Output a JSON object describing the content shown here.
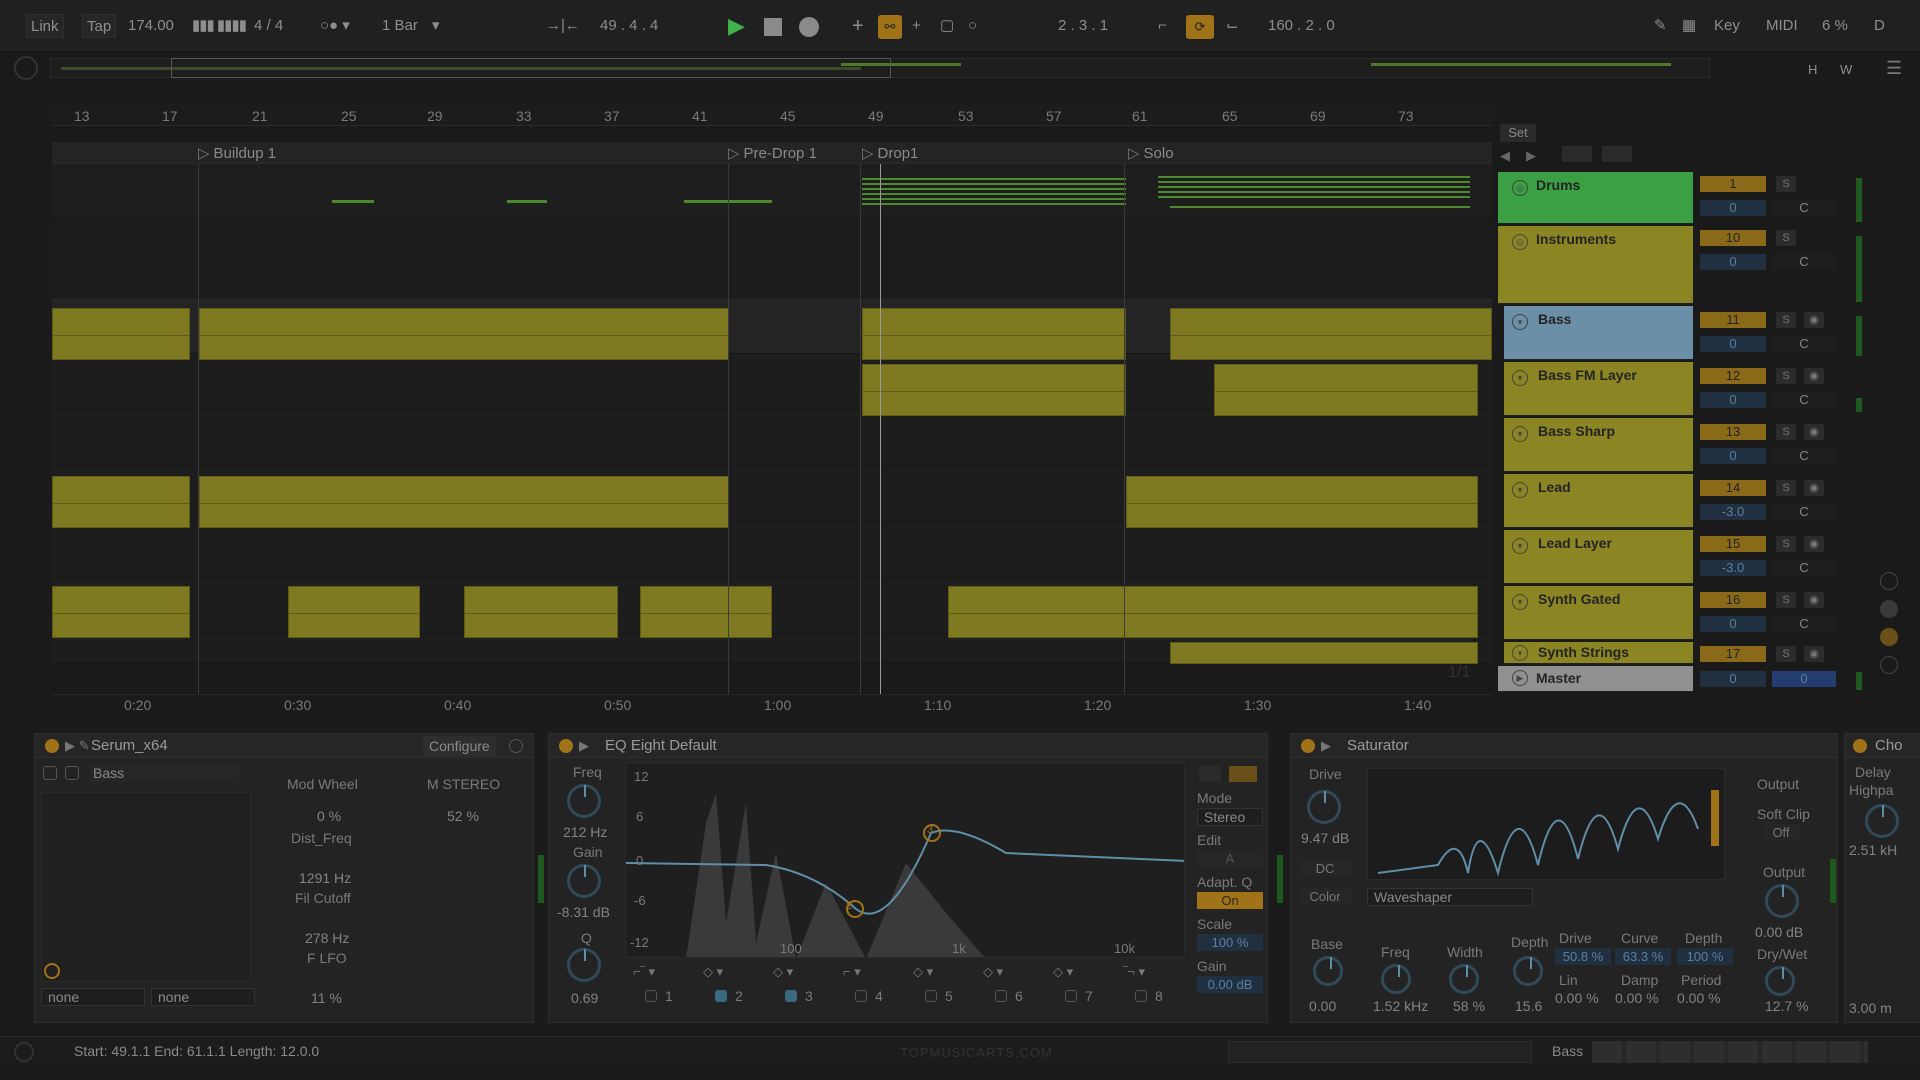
{
  "transport": {
    "link": "Link",
    "tap": "Tap",
    "tempo": "174.00",
    "time_sig": "4 / 4",
    "quantize": "1 Bar",
    "position": "49 .  4 .  4",
    "loop_start": "2 .  3 .  1",
    "loop_length": "160 .  2 .  0",
    "key": "Key",
    "midi": "MIDI",
    "cpu": "6 %",
    "d": "D"
  },
  "overview_buttons": {
    "h": "H",
    "w": "W"
  },
  "ruler": [
    "13",
    "17",
    "21",
    "25",
    "29",
    "33",
    "37",
    "41",
    "45",
    "49",
    "53",
    "57",
    "61",
    "65",
    "69",
    "73"
  ],
  "locators": [
    "Buildup 1",
    "Pre-Drop 1",
    "Drop1",
    "Solo"
  ],
  "time_ruler": [
    "0:20",
    "0:30",
    "0:40",
    "0:50",
    "1:00",
    "1:10",
    "1:20",
    "1:30",
    "1:40"
  ],
  "set_label": "Set",
  "page_indicator": "1/1",
  "tracks": [
    {
      "name": "Drums",
      "num": "1",
      "vol": "0",
      "pan": "C",
      "color": "#3aa043"
    },
    {
      "name": "Instruments",
      "num": "10",
      "vol": "0",
      "pan": "C",
      "color": "#8b8524"
    },
    {
      "name": "Bass",
      "num": "11",
      "vol": "0",
      "pan": "C",
      "color": "#6c8fa8"
    },
    {
      "name": "Bass FM Layer",
      "num": "12",
      "vol": "0",
      "pan": "C",
      "color": "#8b8524"
    },
    {
      "name": "Bass Sharp",
      "num": "13",
      "vol": "0",
      "pan": "C",
      "color": "#8b8524"
    },
    {
      "name": "Lead",
      "num": "14",
      "vol": "-3.0",
      "pan": "C",
      "color": "#8b8524"
    },
    {
      "name": "Lead Layer",
      "num": "15",
      "vol": "-3.0",
      "pan": "C",
      "color": "#8b8524"
    },
    {
      "name": "Synth Gated",
      "num": "16",
      "vol": "0",
      "pan": "C",
      "color": "#8b8524"
    },
    {
      "name": "Synth Strings",
      "num": "17",
      "vol": "",
      "pan": "",
      "color": "#8b8524"
    },
    {
      "name": "Master",
      "num": "0",
      "vol": "0",
      "pan": "",
      "color": "#909090"
    }
  ],
  "mixer_buttons": {
    "solo": "S",
    "cue": "C"
  },
  "serum": {
    "title": "Serum_x64",
    "configure": "Configure",
    "preset": "Bass",
    "mod_wheel": "Mod Wheel",
    "mod_wheel_val": "0 %",
    "m_stereo": "M STEREO",
    "m_stereo_val": "52 %",
    "dist_freq": "Dist_Freq",
    "dist_freq_val": "1291 Hz",
    "fil_cutoff": "Fil Cutoff",
    "fil_cutoff_val": "278 Hz",
    "f_lfo": "F LFO",
    "f_lfo_val": "11 %",
    "sel1": "none",
    "sel2": "none"
  },
  "eq": {
    "title": "EQ Eight Default",
    "freq_label": "Freq",
    "freq_val": "212 Hz",
    "gain_label": "Gain",
    "gain_val": "-8.31 dB",
    "q_label": "Q",
    "q_val": "0.69",
    "db_ticks": [
      "12",
      "6",
      "0",
      "-6",
      "-12"
    ],
    "freq_ticks": [
      "100",
      "1k",
      "10k"
    ],
    "mode_label": "Mode",
    "mode_val": "Stereo",
    "edit_label": "Edit",
    "edit_val": "A",
    "adapt_label": "Adapt. Q",
    "adapt_val": "On",
    "scale_label": "Scale",
    "scale_val": "100 %",
    "gain_out_label": "Gain",
    "gain_out_val": "0.00 dB",
    "bands": [
      "1",
      "2",
      "3",
      "4",
      "5",
      "6",
      "7",
      "8"
    ],
    "band_markers": [
      "2",
      "3"
    ]
  },
  "saturator": {
    "title": "Saturator",
    "drive_label": "Drive",
    "drive_val": "9.47 dB",
    "dc": "DC",
    "color": "Color",
    "type": "Waveshaper",
    "output_label": "Output",
    "soft_clip": "Soft Clip",
    "soft_clip_val": "Off",
    "output_knob_label": "Output",
    "output_val": "0.00 dB",
    "drywet_label": "Dry/Wet",
    "drywet_val": "12.7 %",
    "base_label": "Base",
    "base_val": "0.00",
    "freq_label": "Freq",
    "freq_val": "1.52 kHz",
    "width_label": "Width",
    "width_val": "58 %",
    "depth_label": "Depth",
    "depth_val": "15.6",
    "ws_drive_label": "Drive",
    "ws_drive_val": "50.8 %",
    "curve_label": "Curve",
    "curve_val": "63.3 %",
    "ws_depth_label": "Depth",
    "ws_depth_val": "100 %",
    "lin_label": "Lin",
    "lin_val": "0.00 %",
    "damp_label": "Damp",
    "damp_val": "0.00 %",
    "period_label": "Period",
    "period_val": "0.00 %"
  },
  "chorus": {
    "title": "Cho",
    "delay": "Delay",
    "highpass": "Highpa",
    "val1": "2.51 kH",
    "val2": "3.00 m"
  },
  "status": {
    "selection": "Start: 49.1.1  End: 61.1.1  Length: 12.0.0",
    "watermark": "TOPMUSICARTS.COM",
    "track": "Bass"
  }
}
